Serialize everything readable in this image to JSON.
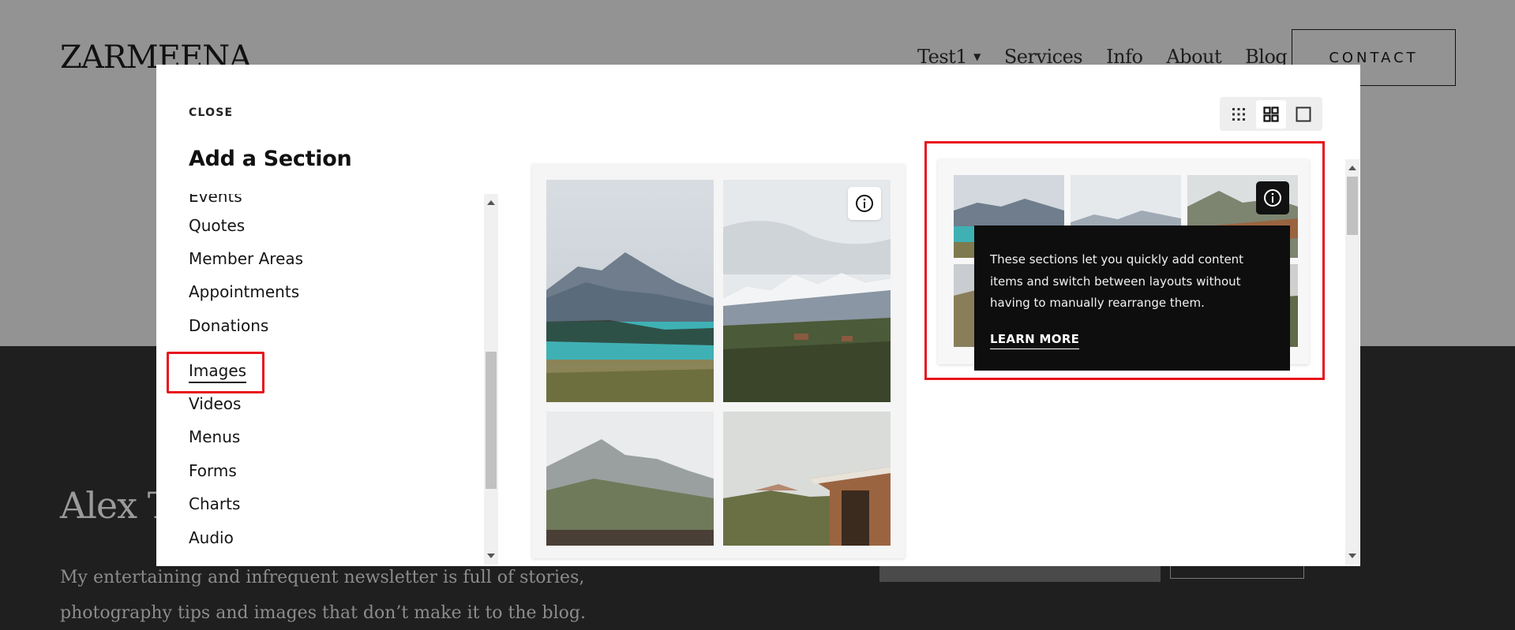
{
  "site": {
    "logo": "ZARMEENA",
    "nav": [
      {
        "label": "Test1",
        "has_dropdown": true
      },
      {
        "label": "Services"
      },
      {
        "label": "Info"
      },
      {
        "label": "About"
      },
      {
        "label": "Blog"
      }
    ],
    "contact_label": "CONTACT",
    "newsletter_title": "Alex Te",
    "newsletter_text": "My entertaining and infrequent newsletter is full of stories, photography tips and images that don’t make it to the blog."
  },
  "modal": {
    "close_label": "CLOSE",
    "title": "Add a Section",
    "categories": [
      "Events",
      "Quotes",
      "Member Areas",
      "Appointments",
      "Donations",
      "Images",
      "Videos",
      "Menus",
      "Forms",
      "Charts",
      "Audio"
    ],
    "active_category": "Images",
    "layout_toggle": {
      "options": [
        "grid-small-icon",
        "grid-large-icon",
        "single-icon"
      ],
      "selected": "grid-large-icon"
    },
    "tooltip": {
      "text": "These sections let you quickly add content items and switch between layouts without having to manually rearrange them.",
      "link_label": "LEARN MORE"
    }
  },
  "colors": {
    "highlight": "#e8141c",
    "overlay_bg": "#939393",
    "dark_bg": "#1f1f1f",
    "tooltip_bg": "#0e0e0e"
  }
}
